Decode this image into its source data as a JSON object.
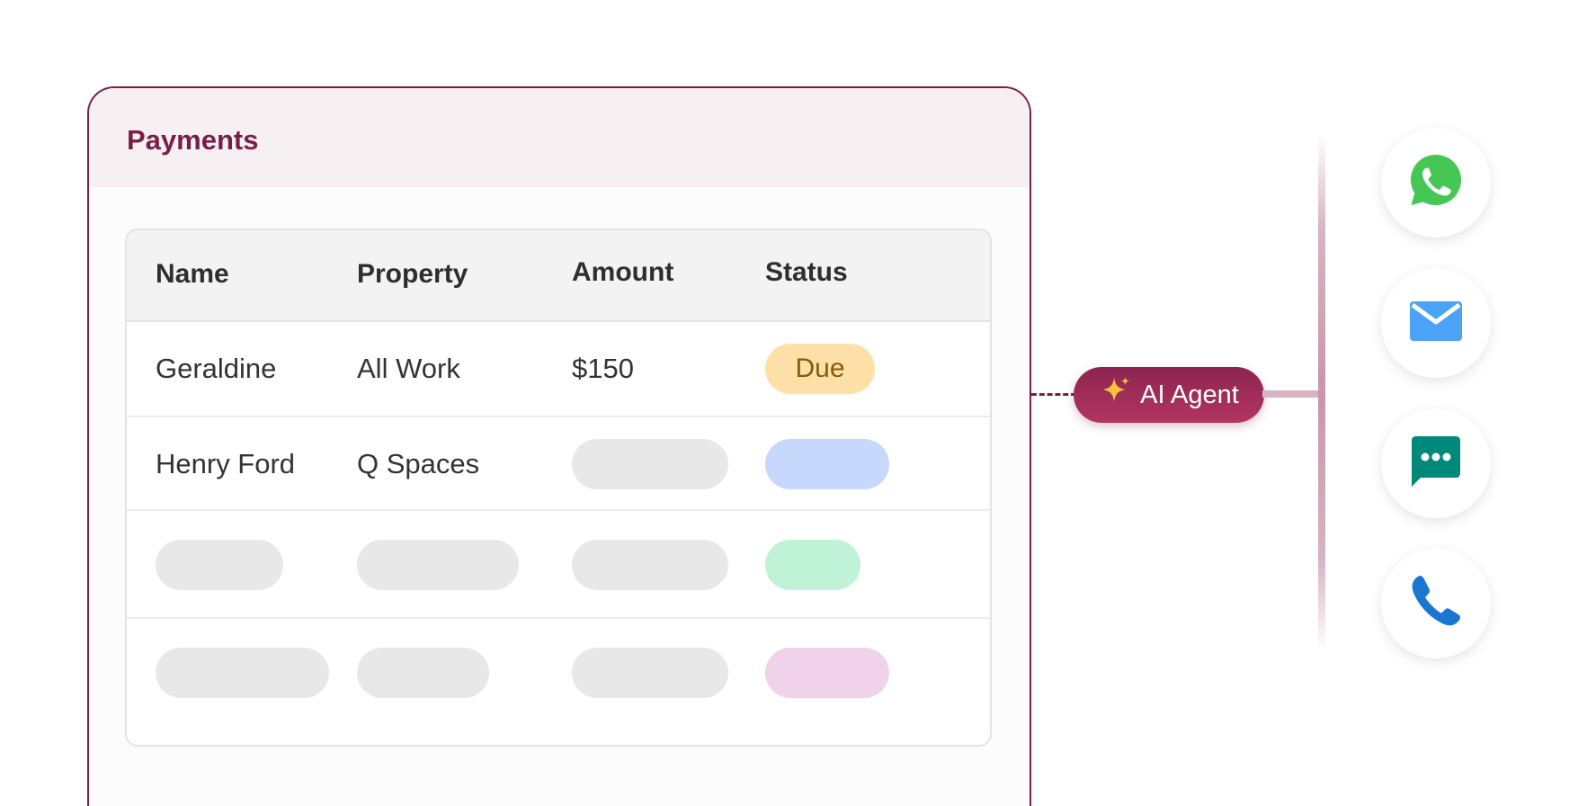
{
  "card": {
    "title": "Payments"
  },
  "table": {
    "headers": [
      "Name",
      "Property",
      "Amount",
      "Status"
    ],
    "rows": [
      {
        "name": "Geraldine",
        "property": "All Work",
        "amount": "$150",
        "status": "Due"
      },
      {
        "name": "Henry Ford",
        "property": "Q Spaces"
      }
    ]
  },
  "agent": {
    "label": "AI Agent",
    "icon": "sparkle-icon"
  },
  "channels": [
    {
      "icon": "whatsapp-icon",
      "color": "#45c756"
    },
    {
      "icon": "mail-icon",
      "color": "#4aa3f5"
    },
    {
      "icon": "chat-icon",
      "color": "#00897b"
    },
    {
      "icon": "phone-icon",
      "color": "#1976d2"
    }
  ],
  "colors": {
    "brand": "#7a1e45",
    "status_due": "#fde0a8",
    "status_blue": "#c6d9fc",
    "status_green": "#bff2d6",
    "status_pink": "#f0d2ea",
    "skeleton": "#e8e8e8"
  }
}
